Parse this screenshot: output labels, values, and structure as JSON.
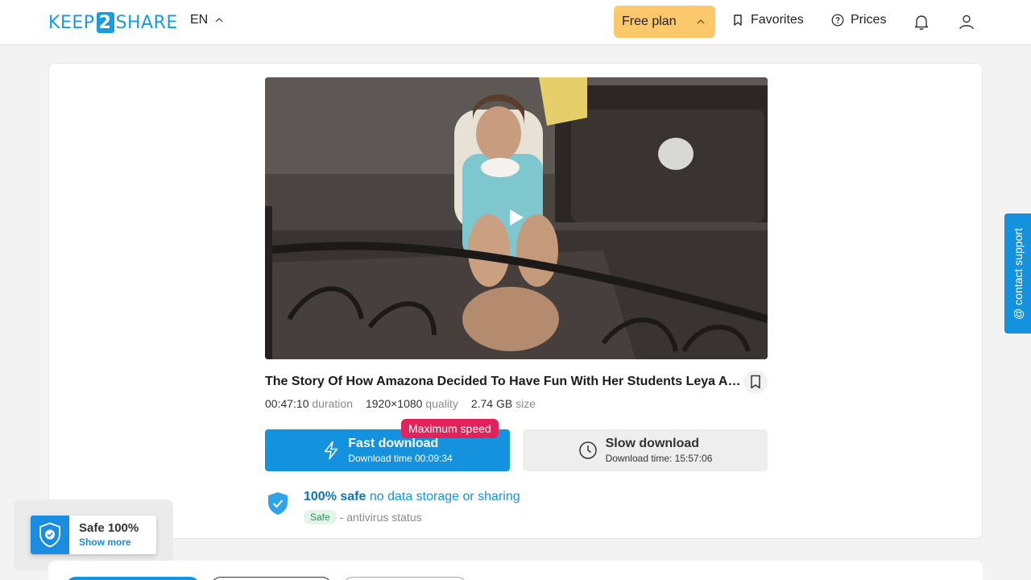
{
  "header": {
    "logo_left": "KEEP",
    "logo_num": "2",
    "logo_right": "SHARE",
    "language": "EN",
    "plan_label": "Free plan",
    "favorites_label": "Favorites",
    "prices_label": "Prices"
  },
  "video": {
    "title": "The Story Of How Amazona Decided To Have Fun With Her Students Leya An...",
    "duration_value": "00:47:10",
    "duration_label": "duration",
    "quality_value": "1920×1080",
    "quality_label": "quality",
    "size_value": "2.74 GB",
    "size_label": "size"
  },
  "download": {
    "badge": "Maximum speed",
    "fast_label": "Fast download",
    "fast_time": "Download time 00:09:34",
    "slow_label": "Slow download",
    "slow_time": "Download time: 15:57:06"
  },
  "safety": {
    "headline_bold": "100% safe",
    "headline_rest": "no data storage or sharing",
    "status_pill": "Safe",
    "status_text": "- antivirus status"
  },
  "widget": {
    "title": "Safe 100%",
    "link": "Show more"
  },
  "support": {
    "label": "@ contact support"
  },
  "colors": {
    "accent": "#1492de",
    "plan_bg": "#fbc76b",
    "badge": "#e0235a"
  }
}
